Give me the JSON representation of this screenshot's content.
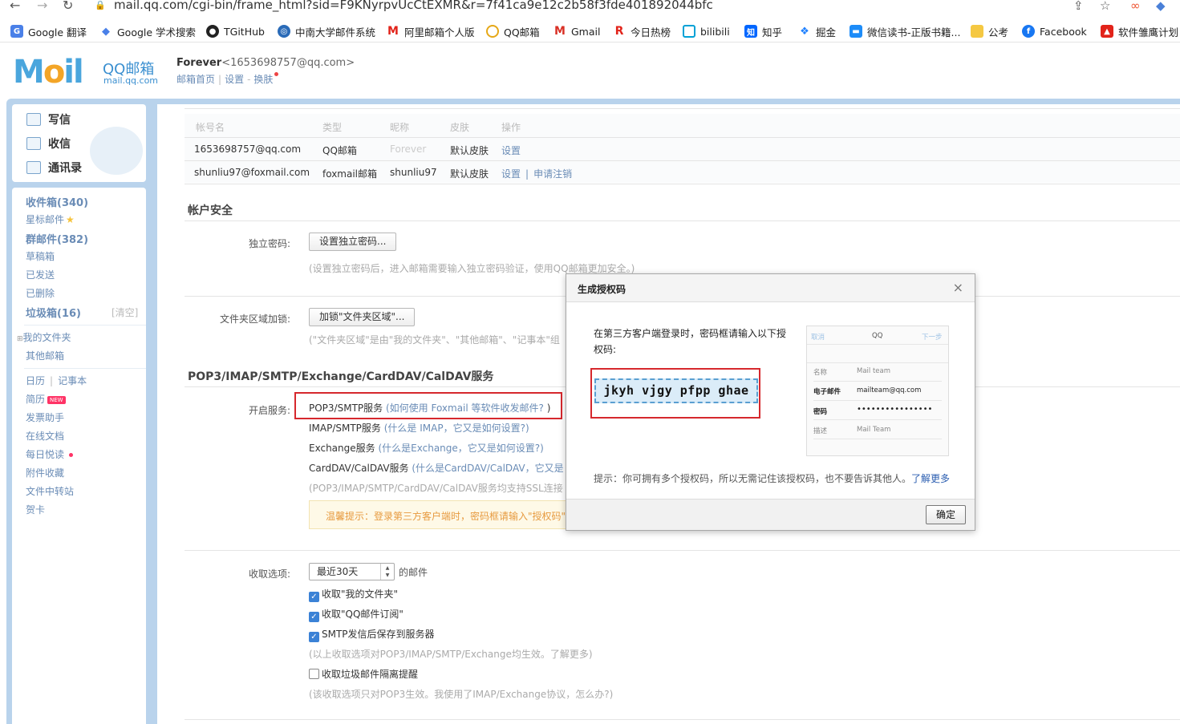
{
  "browser": {
    "url": "mail.qq.com/cgi-bin/frame_html?sid=F9KNyrpvUcCtEXMR&r=7f41ca9e12c2b58f3fde401892044bfc",
    "bookmarks": [
      "Google 翻译",
      "Google 学术搜索",
      "TGitHub",
      "中南大学邮件系统",
      "阿里邮箱个人版",
      "QQ邮箱",
      "Gmail",
      "今日热榜",
      "bilibili",
      "知乎",
      "掘金",
      "微信读书-正版书籍...",
      "公考",
      "Facebook",
      "软件雏鹰计划"
    ]
  },
  "header": {
    "logo": "M",
    "logo_oil": "il",
    "brand_cn": "QQ邮箱",
    "brand_en": "mail.qq.com",
    "user_name": "Forever",
    "user_email": "<1653698757@qq.com>",
    "link_home": "邮箱首页",
    "link_settings": "设置",
    "link_skin": "换肤"
  },
  "sidebar": {
    "compose": "写信",
    "inbox": "收信",
    "contacts": "通讯录",
    "items": {
      "inbox": "收件箱(340)",
      "starred": "星标邮件",
      "group": "群邮件(382)",
      "drafts": "草稿箱",
      "sent": "已发送",
      "deleted": "已删除",
      "spam": "垃圾箱(16)",
      "clear": "[清空]",
      "my_folders": "我的文件夹",
      "other_mail": "其他邮箱",
      "calendar": "日历",
      "notes": "记事本",
      "resume": "简历",
      "new": "NEW",
      "invoice": "发票助手",
      "docs": "在线文档",
      "daily": "每日悦读",
      "attachments": "附件收藏",
      "transfer": "文件中转站",
      "cards": "贺卡"
    }
  },
  "accounts": {
    "headers": [
      "帐号名",
      "类型",
      "昵称",
      "皮肤",
      "操作"
    ],
    "rows": [
      {
        "name": "1653698757@qq.com",
        "type": "QQ邮箱",
        "nick": "Forever",
        "skin": "默认皮肤",
        "op": "设置",
        "op2": ""
      },
      {
        "name": "shunliu97@foxmail.com",
        "type": "foxmail邮箱",
        "nick": "shunliu97",
        "skin": "默认皮肤",
        "op": "设置",
        "op2": "申请注销"
      }
    ]
  },
  "security": {
    "title": "帐户安全",
    "pwd_label": "独立密码:",
    "pwd_button": "设置独立密码...",
    "pwd_hint": "(设置独立密码后，进入邮箱需要输入独立密码验证，使用QQ邮箱更加安全。)",
    "folder_label": "文件夹区域加锁:",
    "folder_button": "加锁\"文件夹区域\"...",
    "folder_hint": "(\"文件夹区域\"是由\"我的文件夹\"、\"其他邮箱\"、\"记事本\"组"
  },
  "services": {
    "title": "POP3/IMAP/SMTP/Exchange/CardDAV/CalDAV服务",
    "label": "开启服务:",
    "pop3": "POP3/SMTP服务",
    "pop3_help": "(如何使用 Foxmail 等软件收发邮件?",
    "pop3_close": ")",
    "imap": "IMAP/SMTP服务",
    "imap_help": "(什么是 IMAP，它又是如何设置?)",
    "exchange": "Exchange服务",
    "exchange_help": "(什么是Exchange，它又是如何设置?)",
    "carddav": "CardDAV/CalDAV服务",
    "carddav_help": "(什么是CardDAV/CalDAV，它又是",
    "ssl_hint": "(POP3/IMAP/SMTP/CardDAV/CalDAV服务均支持SSL连接",
    "tip": "温馨提示：登录第三方客户端时，密码框请输入\"授权码\""
  },
  "receive": {
    "label": "收取选项:",
    "select": "最近30天",
    "suffix": "的邮件",
    "opt1": "收取\"我的文件夹\"",
    "opt2": "收取\"QQ邮件订阅\"",
    "opt3": "SMTP发信后保存到服务器",
    "opt_hint": "(以上收取选项对POP3/IMAP/SMTP/Exchange均生效。了解更多)",
    "opt4": "收取垃圾邮件隔离提醒",
    "opt4_hint": "(该收取选项只对POP3生效。我使用了IMAP/Exchange协议，怎么办?)"
  },
  "dialog": {
    "title": "生成授权码",
    "close": "×",
    "text": "在第三方客户端登录时，密码框请输入以下授权码:",
    "code": "jkyh vjgy pfpp ghae",
    "phone": {
      "cancel": "取消",
      "title": "QQ",
      "next": "下一步",
      "name_label": "名称",
      "name_value": "Mail team",
      "email_label": "电子邮件",
      "email_value": "mailteam@qq.com",
      "pwd_label": "密码",
      "pwd_value": "••••••••••••••••",
      "desc_label": "描述",
      "desc_value": "Mail Team"
    },
    "hint": "提示：你可拥有多个授权码，所以无需记住该授权码，也不要告诉其他人。",
    "hint_link": "了解更多",
    "ok": "确定"
  }
}
